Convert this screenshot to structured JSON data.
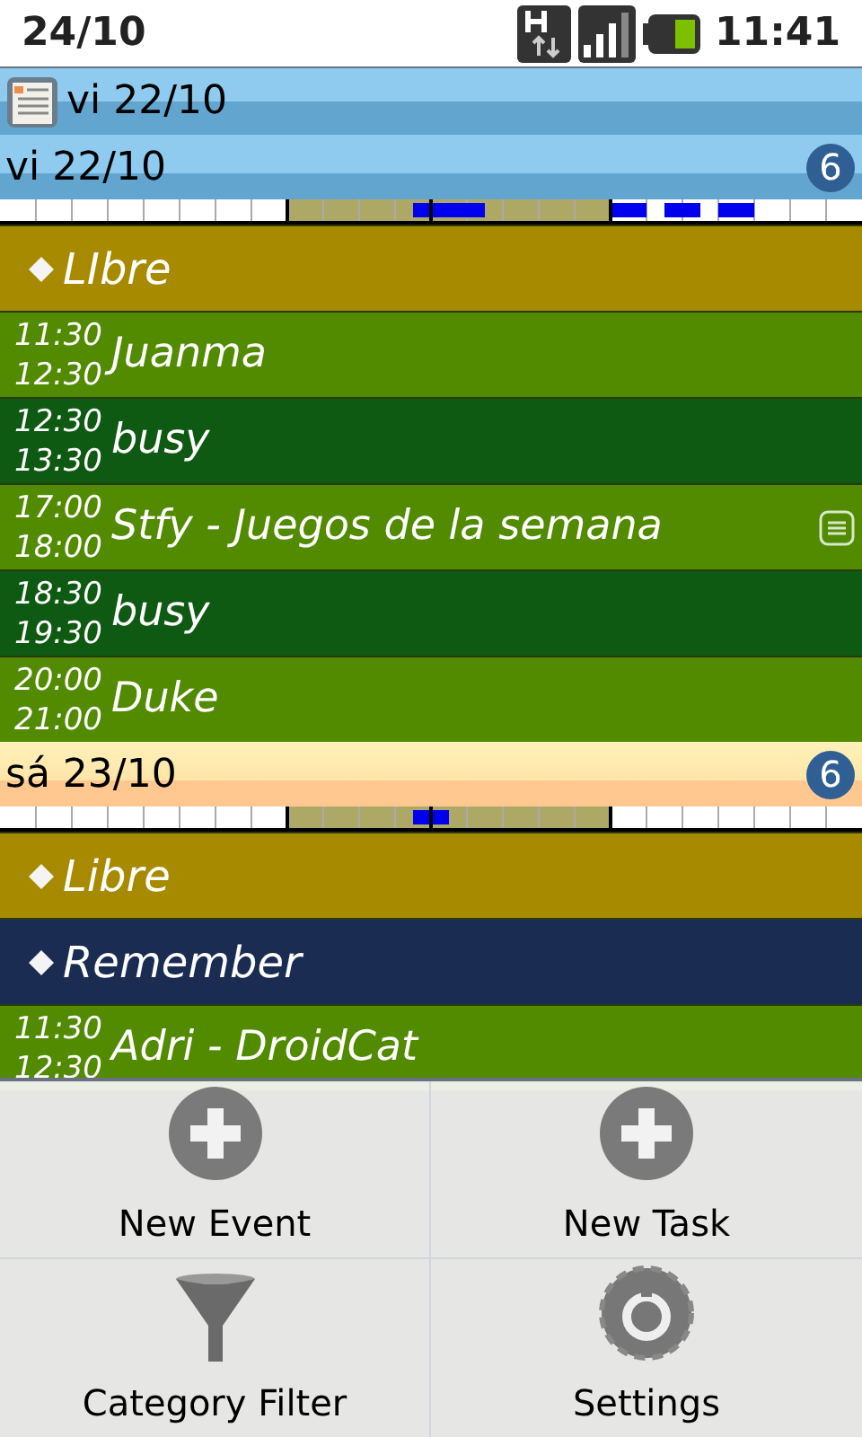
{
  "status_bar": {
    "date": "24/10",
    "time": "11:41"
  },
  "title_bar": {
    "title": "vi 22/10"
  },
  "days": [
    {
      "label": "vi 22/10",
      "count": "6",
      "items": [
        {
          "kind": "free",
          "title": "LIbre",
          "color": "#a88a00"
        },
        {
          "kind": "event",
          "start": "11:30",
          "end": "12:30",
          "title": "Juanma",
          "color": "#528a00",
          "has_note": false
        },
        {
          "kind": "event",
          "start": "12:30",
          "end": "13:30",
          "title": "busy",
          "color": "#0f5a12",
          "has_note": false
        },
        {
          "kind": "event",
          "start": "17:00",
          "end": "18:00",
          "title": "Stfy - Juegos de la semana",
          "color": "#528a00",
          "has_note": true
        },
        {
          "kind": "event",
          "start": "18:30",
          "end": "19:30",
          "title": "busy",
          "color": "#0f5a12",
          "has_note": false
        },
        {
          "kind": "event",
          "start": "20:00",
          "end": "21:00",
          "title": "Duke",
          "color": "#528a00",
          "has_note": false
        }
      ]
    },
    {
      "label": "sá 23/10",
      "count": "6",
      "items": [
        {
          "kind": "free",
          "title": "Libre",
          "color": "#a88a00"
        },
        {
          "kind": "free",
          "title": "Remember",
          "color": "#1b2c52"
        },
        {
          "kind": "event",
          "start": "11:30",
          "end": "12:30",
          "title": "Adri - DroidCat",
          "color": "#528a00",
          "has_note": false
        }
      ]
    }
  ],
  "menu": [
    {
      "label": "New Event"
    },
    {
      "label": "New Task"
    },
    {
      "label": "Category Filter"
    },
    {
      "label": "Settings"
    }
  ]
}
